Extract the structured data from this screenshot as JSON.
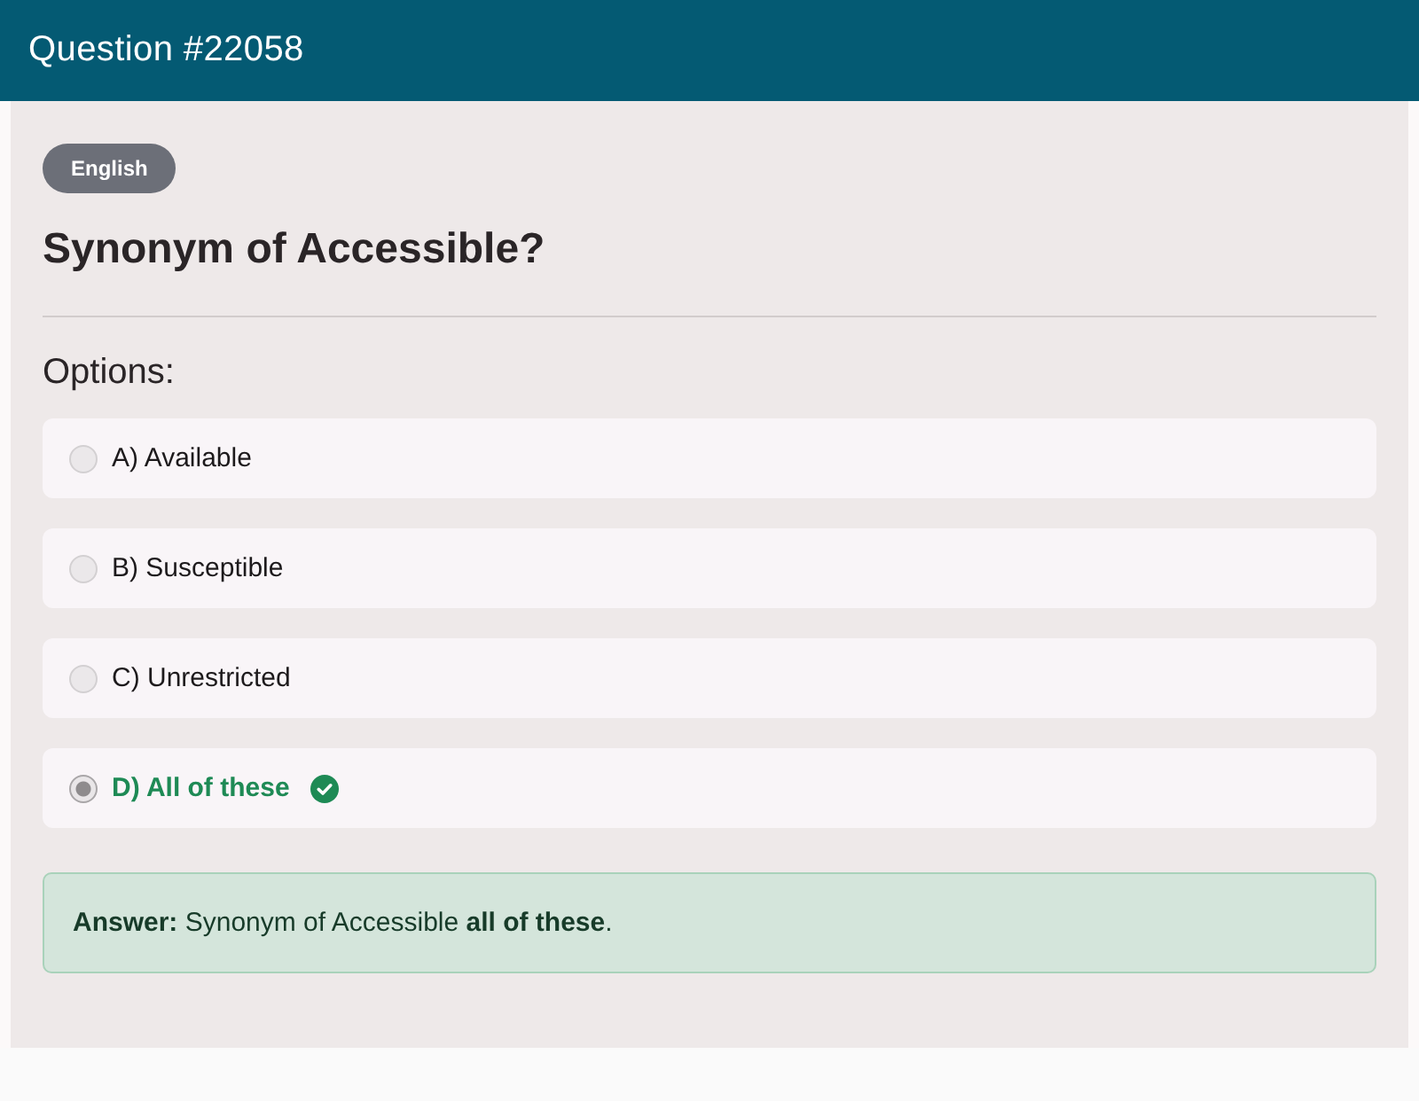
{
  "header": {
    "title": "Question #22058"
  },
  "question": {
    "category": "English",
    "text": "Synonym of Accessible?"
  },
  "options_label": "Options:",
  "options": [
    {
      "label": "A) Available",
      "selected": false,
      "correct": false
    },
    {
      "label": "B) Susceptible",
      "selected": false,
      "correct": false
    },
    {
      "label": "C) Unrestricted",
      "selected": false,
      "correct": false
    },
    {
      "label": "D) All of these",
      "selected": true,
      "correct": true
    }
  ],
  "answer": {
    "text": "**Answer:** Synonym of Accessible **all of these**."
  }
}
